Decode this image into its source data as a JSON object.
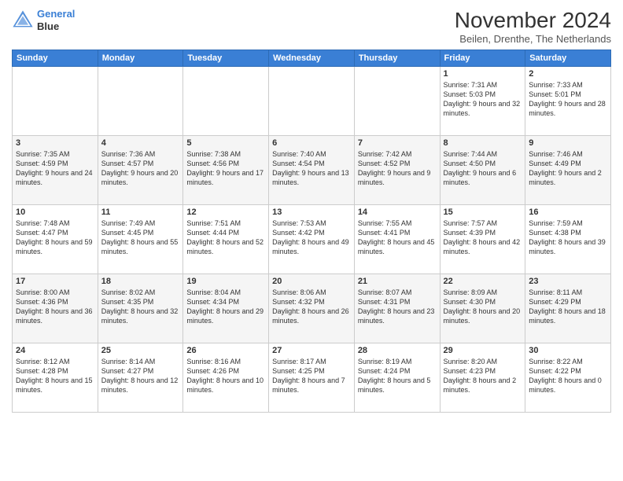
{
  "header": {
    "logo_line1": "General",
    "logo_line2": "Blue",
    "month_title": "November 2024",
    "subtitle": "Beilen, Drenthe, The Netherlands"
  },
  "days_of_week": [
    "Sunday",
    "Monday",
    "Tuesday",
    "Wednesday",
    "Thursday",
    "Friday",
    "Saturday"
  ],
  "weeks": [
    [
      {
        "day": "",
        "info": ""
      },
      {
        "day": "",
        "info": ""
      },
      {
        "day": "",
        "info": ""
      },
      {
        "day": "",
        "info": ""
      },
      {
        "day": "",
        "info": ""
      },
      {
        "day": "1",
        "info": "Sunrise: 7:31 AM\nSunset: 5:03 PM\nDaylight: 9 hours and 32 minutes."
      },
      {
        "day": "2",
        "info": "Sunrise: 7:33 AM\nSunset: 5:01 PM\nDaylight: 9 hours and 28 minutes."
      }
    ],
    [
      {
        "day": "3",
        "info": "Sunrise: 7:35 AM\nSunset: 4:59 PM\nDaylight: 9 hours and 24 minutes."
      },
      {
        "day": "4",
        "info": "Sunrise: 7:36 AM\nSunset: 4:57 PM\nDaylight: 9 hours and 20 minutes."
      },
      {
        "day": "5",
        "info": "Sunrise: 7:38 AM\nSunset: 4:56 PM\nDaylight: 9 hours and 17 minutes."
      },
      {
        "day": "6",
        "info": "Sunrise: 7:40 AM\nSunset: 4:54 PM\nDaylight: 9 hours and 13 minutes."
      },
      {
        "day": "7",
        "info": "Sunrise: 7:42 AM\nSunset: 4:52 PM\nDaylight: 9 hours and 9 minutes."
      },
      {
        "day": "8",
        "info": "Sunrise: 7:44 AM\nSunset: 4:50 PM\nDaylight: 9 hours and 6 minutes."
      },
      {
        "day": "9",
        "info": "Sunrise: 7:46 AM\nSunset: 4:49 PM\nDaylight: 9 hours and 2 minutes."
      }
    ],
    [
      {
        "day": "10",
        "info": "Sunrise: 7:48 AM\nSunset: 4:47 PM\nDaylight: 8 hours and 59 minutes."
      },
      {
        "day": "11",
        "info": "Sunrise: 7:49 AM\nSunset: 4:45 PM\nDaylight: 8 hours and 55 minutes."
      },
      {
        "day": "12",
        "info": "Sunrise: 7:51 AM\nSunset: 4:44 PM\nDaylight: 8 hours and 52 minutes."
      },
      {
        "day": "13",
        "info": "Sunrise: 7:53 AM\nSunset: 4:42 PM\nDaylight: 8 hours and 49 minutes."
      },
      {
        "day": "14",
        "info": "Sunrise: 7:55 AM\nSunset: 4:41 PM\nDaylight: 8 hours and 45 minutes."
      },
      {
        "day": "15",
        "info": "Sunrise: 7:57 AM\nSunset: 4:39 PM\nDaylight: 8 hours and 42 minutes."
      },
      {
        "day": "16",
        "info": "Sunrise: 7:59 AM\nSunset: 4:38 PM\nDaylight: 8 hours and 39 minutes."
      }
    ],
    [
      {
        "day": "17",
        "info": "Sunrise: 8:00 AM\nSunset: 4:36 PM\nDaylight: 8 hours and 36 minutes."
      },
      {
        "day": "18",
        "info": "Sunrise: 8:02 AM\nSunset: 4:35 PM\nDaylight: 8 hours and 32 minutes."
      },
      {
        "day": "19",
        "info": "Sunrise: 8:04 AM\nSunset: 4:34 PM\nDaylight: 8 hours and 29 minutes."
      },
      {
        "day": "20",
        "info": "Sunrise: 8:06 AM\nSunset: 4:32 PM\nDaylight: 8 hours and 26 minutes."
      },
      {
        "day": "21",
        "info": "Sunrise: 8:07 AM\nSunset: 4:31 PM\nDaylight: 8 hours and 23 minutes."
      },
      {
        "day": "22",
        "info": "Sunrise: 8:09 AM\nSunset: 4:30 PM\nDaylight: 8 hours and 20 minutes."
      },
      {
        "day": "23",
        "info": "Sunrise: 8:11 AM\nSunset: 4:29 PM\nDaylight: 8 hours and 18 minutes."
      }
    ],
    [
      {
        "day": "24",
        "info": "Sunrise: 8:12 AM\nSunset: 4:28 PM\nDaylight: 8 hours and 15 minutes."
      },
      {
        "day": "25",
        "info": "Sunrise: 8:14 AM\nSunset: 4:27 PM\nDaylight: 8 hours and 12 minutes."
      },
      {
        "day": "26",
        "info": "Sunrise: 8:16 AM\nSunset: 4:26 PM\nDaylight: 8 hours and 10 minutes."
      },
      {
        "day": "27",
        "info": "Sunrise: 8:17 AM\nSunset: 4:25 PM\nDaylight: 8 hours and 7 minutes."
      },
      {
        "day": "28",
        "info": "Sunrise: 8:19 AM\nSunset: 4:24 PM\nDaylight: 8 hours and 5 minutes."
      },
      {
        "day": "29",
        "info": "Sunrise: 8:20 AM\nSunset: 4:23 PM\nDaylight: 8 hours and 2 minutes."
      },
      {
        "day": "30",
        "info": "Sunrise: 8:22 AM\nSunset: 4:22 PM\nDaylight: 8 hours and 0 minutes."
      }
    ]
  ]
}
